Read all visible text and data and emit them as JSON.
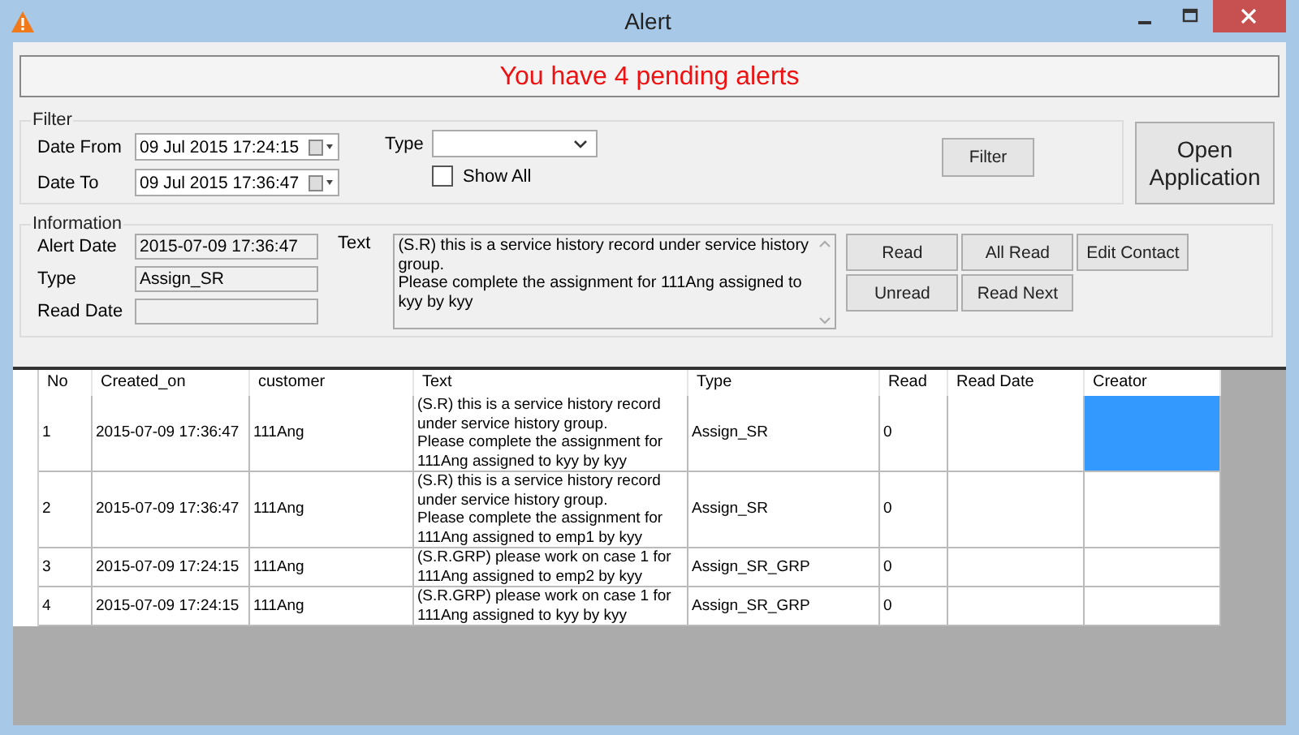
{
  "window": {
    "title": "Alert"
  },
  "banner": "You have 4 pending alerts",
  "filter": {
    "title": "Filter",
    "date_from_label": "Date From",
    "date_from": "09  Jul  2015 17:24:15",
    "date_to_label": "Date To",
    "date_to": "09  Jul  2015 17:36:47",
    "type_label": "Type",
    "show_all": {
      "label": "Show All",
      "checked": false
    },
    "filter_button": "Filter"
  },
  "open_button": "Open\nApplication",
  "information": {
    "title": "Information",
    "alert_date_label": "Alert Date",
    "alert_date": "2015-07-09 17:36:47",
    "type_label": "Type",
    "type": "Assign_SR",
    "read_date_label": "Read Date",
    "text_label": "Text",
    "text": "(S.R) this is a service history record under service history group.\nPlease complete the assignment  for 111Ang assigned to kyy by kyy",
    "buttons": [
      [
        "Read",
        "All Read",
        "Edit Contact"
      ],
      [
        "Unread",
        "Read Next"
      ]
    ]
  },
  "table": {
    "columns": [
      "No",
      "Created_on",
      "customer",
      "Text",
      "Type",
      "Read",
      "Read Date",
      "Creator"
    ],
    "rows": [
      {
        "cells": [
          "1",
          "2015-07-09 17:36:47",
          "111Ang",
          "(S.R) this is a service history record\nunder service history group.\nPlease complete the assignment  for\n111Ang assigned to kyy by kyy",
          "Assign_SR",
          "0"
        ],
        "selected": true
      },
      {
        "cells": [
          "2",
          "2015-07-09 17:36:47",
          "111Ang",
          "(S.R) this is a service history record\nunder service history group.\nPlease complete the assignment  for\n111Ang assigned to emp1 by kyy",
          "Assign_SR",
          "0"
        ],
        "selected": false
      },
      {
        "cells": [
          "3",
          "2015-07-09 17:24:15",
          "111Ang",
          "(S.R.GRP) please work on case 1  for\n111Ang assigned to emp2 by kyy",
          "Assign_SR_GRP",
          "0"
        ],
        "selected": false
      },
      {
        "cells": [
          "4",
          "2015-07-09 17:24:15",
          "111Ang",
          "(S.R.GRP) please work on case 1  for\n111Ang assigned to kyy by kyy",
          "Assign_SR_GRP",
          "0"
        ],
        "selected": false
      }
    ]
  }
}
